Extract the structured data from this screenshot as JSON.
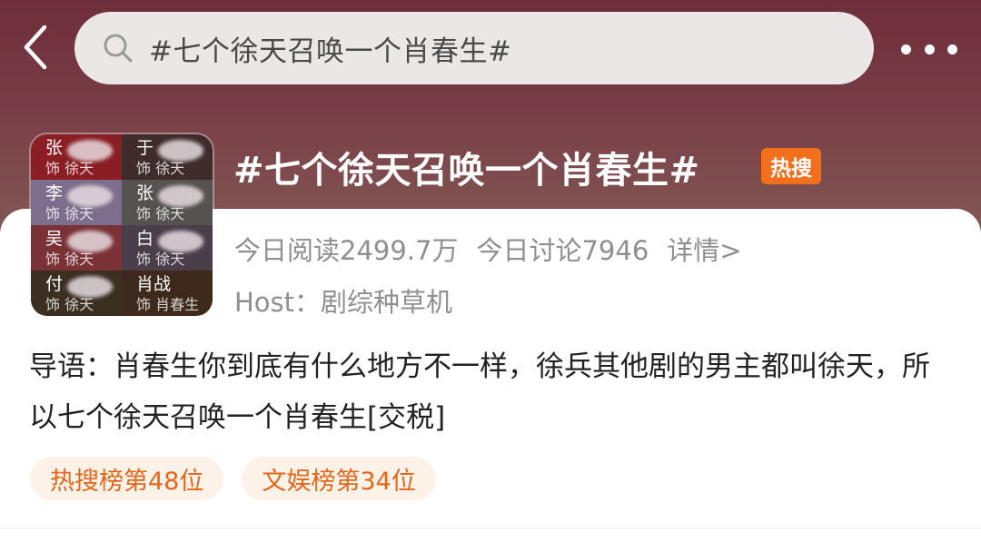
{
  "header": {
    "search_text": "#七个徐天召唤一个肖春生#",
    "icons": {
      "back": "back-chevron-icon",
      "search": "search-icon",
      "more": "more-dots-icon"
    }
  },
  "topic": {
    "title": "#七个徐天召唤一个肖春生#",
    "badge": "热搜",
    "badge_color": "#f26f1e"
  },
  "thumbnail": {
    "cells": [
      {
        "name": "张",
        "role": "饰 徐天"
      },
      {
        "name": "于",
        "role": "饰 徐天"
      },
      {
        "name": "李",
        "role": "饰 徐天"
      },
      {
        "name": "张",
        "role": "饰 徐天"
      },
      {
        "name": "吴",
        "role": "饰 徐天"
      },
      {
        "name": "白",
        "role": "饰 徐天"
      },
      {
        "name": "付",
        "role": "饰 徐天"
      },
      {
        "name": "肖战",
        "role": "饰 肖春生"
      }
    ]
  },
  "stats": {
    "reads": "今日阅读2499.7万",
    "discussions": "今日讨论7946",
    "details": "详情>"
  },
  "host": "Host：剧综种草机",
  "intro": "导语：肖春生你到底有什么地方不一样，徐兵其他剧的男主都叫徐天，所以七个徐天召唤一个肖春生[交税]",
  "tags": [
    "热搜榜第48位",
    "文娱榜第34位"
  ],
  "colors": {
    "accent": "#e2661b",
    "tag_bg": "#fdf2e7",
    "header_gradient_top": "#6e2d3a"
  }
}
